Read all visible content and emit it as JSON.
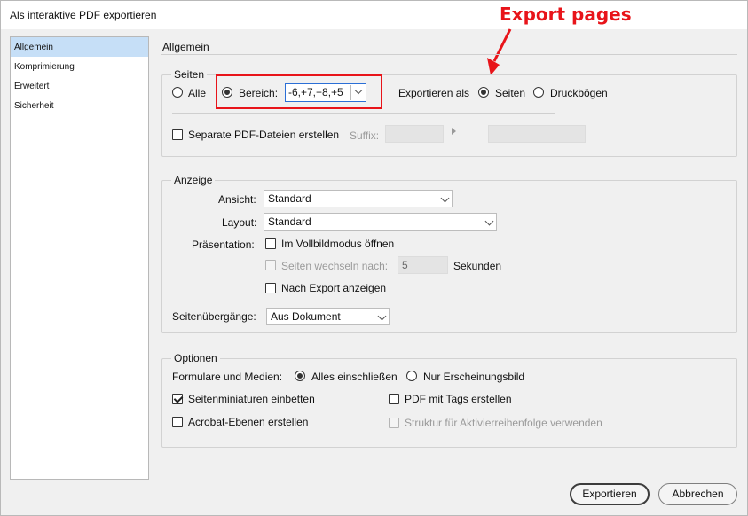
{
  "window": {
    "title": "Als interaktive PDF exportieren"
  },
  "annotation": {
    "text": "Export pages",
    "color": "#e8141a"
  },
  "sidebar": {
    "items": [
      {
        "label": "Allgemein",
        "selected": true
      },
      {
        "label": "Komprimierung",
        "selected": false
      },
      {
        "label": "Erweitert",
        "selected": false
      },
      {
        "label": "Sicherheit",
        "selected": false
      }
    ]
  },
  "main": {
    "heading": "Allgemein",
    "seiten": {
      "title": "Seiten",
      "all_label": "Alle",
      "range_label": "Bereich:",
      "range_value": "-6,+7,+8,+5",
      "export_as_label": "Exportieren als",
      "pages_label": "Seiten",
      "spreads_label": "Druckbögen",
      "separate_label": "Separate PDF-Dateien erstellen",
      "suffix_label": "Suffix:"
    },
    "anzeige": {
      "title": "Anzeige",
      "view_label": "Ansicht:",
      "view_value": "Standard",
      "layout_label": "Layout:",
      "layout_value": "Standard",
      "presentation_label": "Präsentation:",
      "fullscreen_label": "Im Vollbildmodus öffnen",
      "flip_label": "Seiten wechseln nach:",
      "flip_value": "5",
      "seconds_label": "Sekunden",
      "after_export_label": "Nach Export anzeigen",
      "transitions_label": "Seitenübergänge:",
      "transitions_value": "Aus Dokument"
    },
    "optionen": {
      "title": "Optionen",
      "forms_label": "Formulare und Medien:",
      "include_all_label": "Alles einschließen",
      "appearance_only_label": "Nur Erscheinungsbild",
      "thumbnails_label": "Seitenminiaturen einbetten",
      "tagged_pdf_label": "PDF mit Tags erstellen",
      "acrobat_layers_label": "Acrobat-Ebenen erstellen",
      "tab_order_label": "Struktur für Aktivierreihenfolge verwenden"
    }
  },
  "footer": {
    "export_label": "Exportieren",
    "cancel_label": "Abbrechen"
  }
}
